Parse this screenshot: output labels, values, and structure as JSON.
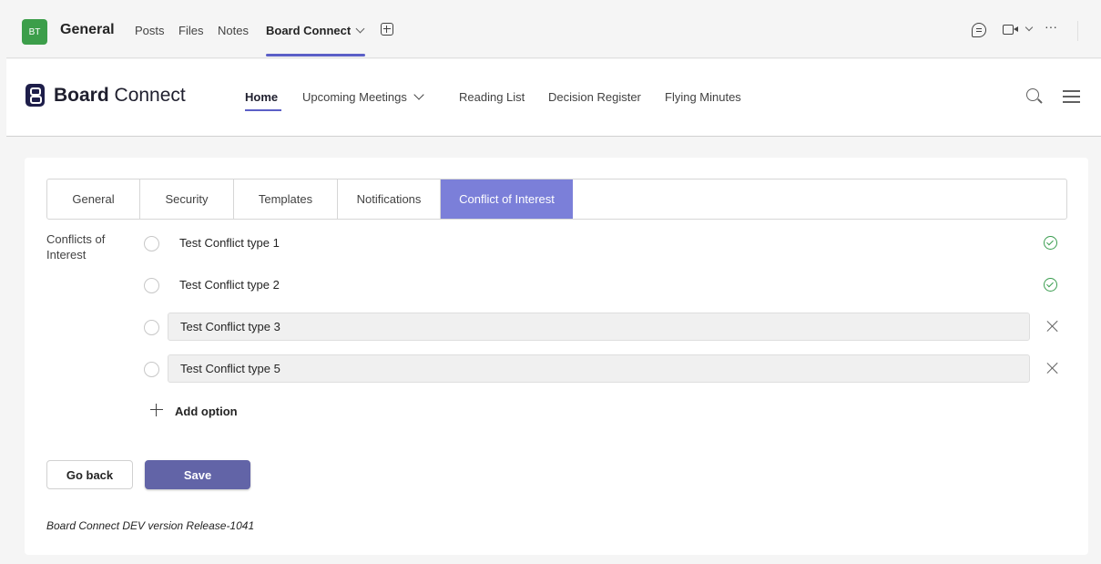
{
  "teams_header": {
    "avatar_initials": "BT",
    "channel_name": "General",
    "tabs": [
      {
        "label": "Posts"
      },
      {
        "label": "Files"
      },
      {
        "label": "Notes"
      },
      {
        "label": "Board Connect",
        "active": true
      }
    ],
    "icons": [
      "chat-icon",
      "video-call-icon",
      "chevron-down-icon",
      "more-icon",
      "add-tab-icon"
    ],
    "more_label": "···"
  },
  "app_nav": {
    "brand_bold": "Board",
    "brand_rest": " Connect",
    "links": [
      {
        "label": "Home",
        "active": true
      },
      {
        "label": "Upcoming Meetings",
        "has_dropdown": true
      },
      {
        "label": "Reading List"
      },
      {
        "label": "Decision Register"
      },
      {
        "label": "Flying Minutes"
      }
    ]
  },
  "settings": {
    "tabs": [
      {
        "label": "General"
      },
      {
        "label": "Security"
      },
      {
        "label": "Templates"
      },
      {
        "label": "Notifications"
      },
      {
        "label": "Conflict of Interest",
        "active": true
      }
    ],
    "section_label": "Conflicts of Interest",
    "options": [
      {
        "label": "Test Conflict type 1",
        "editable": false,
        "status": "saved"
      },
      {
        "label": "Test Conflict type 2",
        "editable": false,
        "status": "saved"
      },
      {
        "label": "Test Conflict type 3",
        "editable": true,
        "status": "removable"
      },
      {
        "label": "Test Conflict type 5",
        "editable": true,
        "status": "removable"
      }
    ],
    "add_option_label": "Add option",
    "go_back_label": "Go back",
    "save_label": "Save",
    "version_text": "Board Connect DEV version Release-1041"
  },
  "colors": {
    "accent": "#5b5fc7",
    "active_tab": "#7b7fd9",
    "save_button": "#6264a7",
    "avatar": "#3c9e4a",
    "success": "#3a9d4f"
  }
}
